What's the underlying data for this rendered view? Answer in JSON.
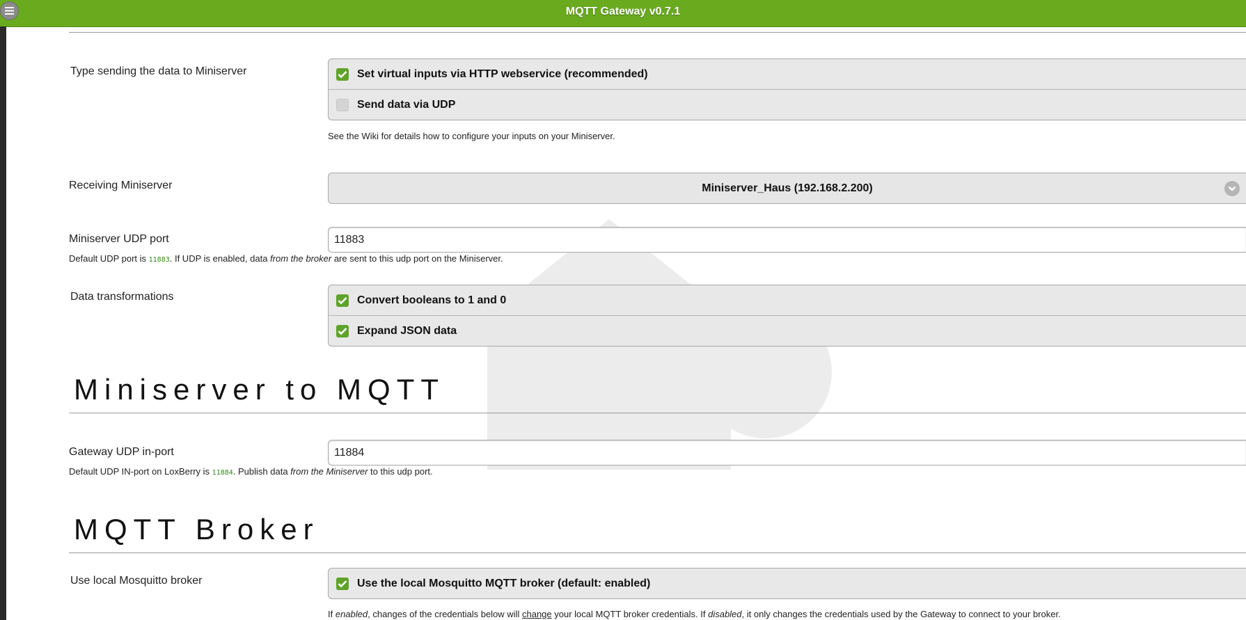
{
  "header": {
    "title": "MQTT Gateway v0.7.1",
    "menu_icon": "menu-icon"
  },
  "colors": {
    "header_bg": "#6aaa1e",
    "checkbox_on": "#5fa32a",
    "code_green": "#2e8b14"
  },
  "sending_type": {
    "label": "Type sending the data to Miniserver",
    "options": [
      {
        "label": "Set virtual inputs via HTTP webservice (recommended)",
        "checked": true
      },
      {
        "label": "Send data via UDP",
        "checked": false
      }
    ],
    "hint": "See the Wiki for details how to configure your inputs on your Miniserver."
  },
  "receiving_miniserver": {
    "label": "Receiving Miniserver",
    "selected": "Miniserver_Haus (192.168.2.200)"
  },
  "udp_port": {
    "label": "Miniserver UDP port",
    "value": "11883",
    "hint_pre": "Default UDP port is ",
    "hint_code": "11883",
    "hint_mid": ". If UDP is enabled, data ",
    "hint_em": "from the broker",
    "hint_post": " are sent to this udp port on the Miniserver."
  },
  "transformations": {
    "label": "Data transformations",
    "options": [
      {
        "label": "Convert booleans to 1 and 0",
        "checked": true
      },
      {
        "label": "Expand JSON data",
        "checked": true
      }
    ]
  },
  "section_ms_to_mqtt": {
    "title": "Miniserver to MQTT"
  },
  "gateway_port": {
    "label": "Gateway UDP in-port",
    "value": "11884",
    "hint_pre": "Default UDP IN-port on LoxBerry is ",
    "hint_code": "11884",
    "hint_mid": ". Publish data ",
    "hint_em": "from the Miniserver",
    "hint_post": " to this udp port."
  },
  "section_broker": {
    "title": "MQTT Broker"
  },
  "local_broker": {
    "label": "Use local Mosquitto broker",
    "options": [
      {
        "label": "Use the local Mosquitto MQTT broker (default: enabled)",
        "checked": true
      }
    ],
    "hint_p1": "If ",
    "hint_em1": "enabled",
    "hint_p2": ", changes of the credentials below will ",
    "hint_u": "change",
    "hint_p3": " your local MQTT broker credentials. If ",
    "hint_em2": "disabled",
    "hint_p4": ", it only changes the credentials used by the Gateway to connect to your broker."
  }
}
